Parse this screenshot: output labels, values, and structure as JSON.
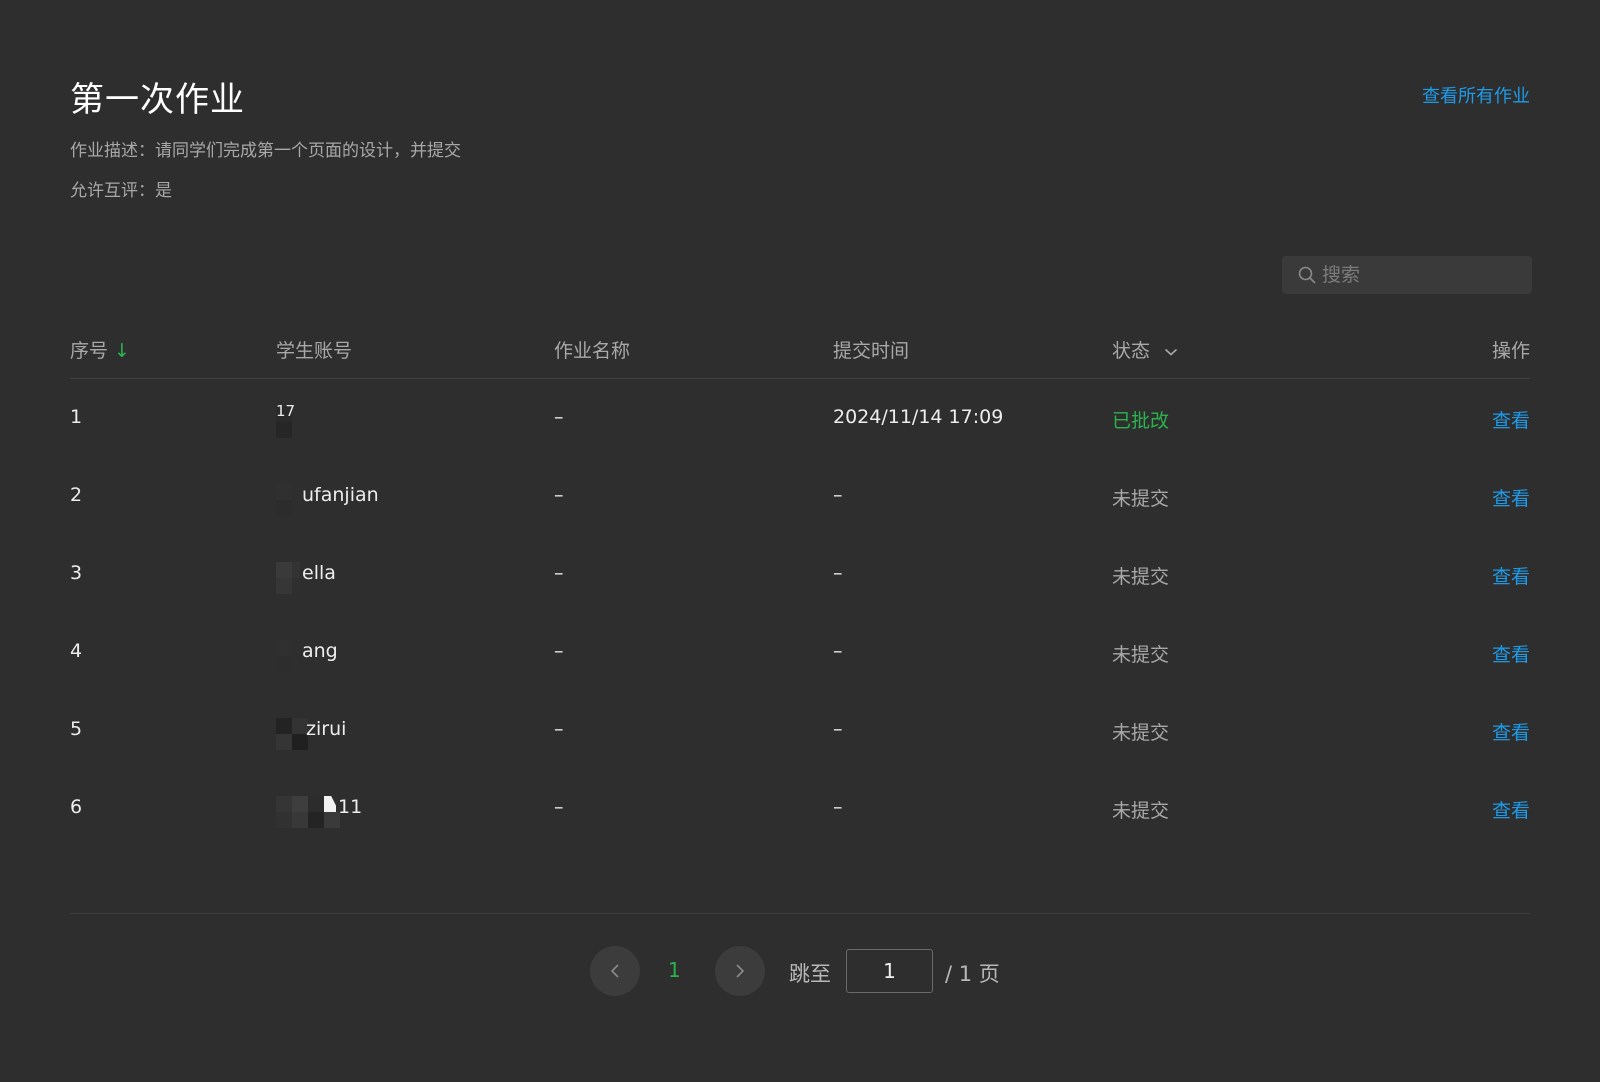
{
  "header": {
    "title": "第一次作业",
    "view_all_label": "查看所有作业",
    "description": "作业描述：请同学们完成第一个页面的设计，并提交",
    "peer_review": "允许互评：是"
  },
  "search": {
    "placeholder": "搜索",
    "icon": "search-icon"
  },
  "table": {
    "columns": {
      "index": "序号",
      "sort_indicator": "↓",
      "account": "学生账号",
      "homework_name": "作业名称",
      "submit_time": "提交时间",
      "status": "状态",
      "action": "操作"
    },
    "rows": [
      {
        "index": "1",
        "account": "17",
        "homework_name": "–",
        "submit_time": "2024/11/14 17:09",
        "status": "已批改",
        "action": "查看"
      },
      {
        "index": "2",
        "account": "ufanjian",
        "homework_name": "–",
        "submit_time": "–",
        "status": "未提交",
        "action": "查看"
      },
      {
        "index": "3",
        "account": "ella",
        "homework_name": "–",
        "submit_time": "–",
        "status": "未提交",
        "action": "查看"
      },
      {
        "index": "4",
        "account": "ang",
        "homework_name": "–",
        "submit_time": "–",
        "status": "未提交",
        "action": "查看"
      },
      {
        "index": "5",
        "account": "zirui",
        "homework_name": "–",
        "submit_time": "–",
        "status": "未提交",
        "action": "查看"
      },
      {
        "index": "6",
        "account": "11",
        "homework_name": "–",
        "submit_time": "–",
        "status": "未提交",
        "action": "查看"
      }
    ]
  },
  "pagination": {
    "current_page": "1",
    "jump_label": "跳至",
    "jump_value": "1",
    "total_label": "/ 1 页"
  },
  "colors": {
    "background": "#2e2e2e",
    "accent_link": "#1e9be8",
    "success_green": "#2bb34e",
    "muted_text": "#a8a8a8"
  }
}
